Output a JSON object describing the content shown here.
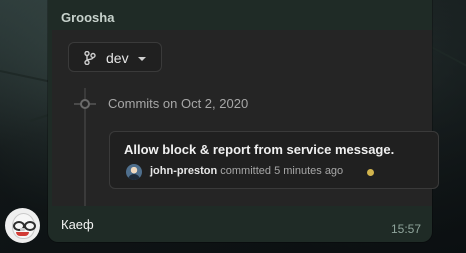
{
  "message": {
    "sender": "Groosha",
    "text": "Каеф",
    "time": "15:57"
  },
  "preview": {
    "branch": {
      "label": "dev",
      "icon": "git-branch-icon",
      "dropdown_icon": "chevron-down-icon"
    },
    "commits_heading": "Commits on Oct 2, 2020",
    "commit": {
      "title": "Allow block & report from service message.",
      "author": "john-preston",
      "action_text": "committed 5 minutes ago",
      "status_color": "#d2b44d"
    }
  },
  "colors": {
    "bubble": "#1f2b26",
    "card": "#252525",
    "accent_text": "#c7d2cc"
  }
}
